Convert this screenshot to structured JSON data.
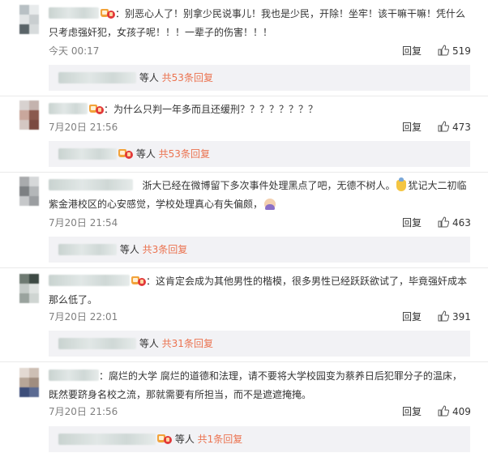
{
  "reply_label": "回复",
  "others_label": "等人",
  "icons": {
    "like": "thumbs-up-icon",
    "vip": "vip-crown-icon"
  },
  "colors": {
    "accent": "#eb7350",
    "meta": "#808080",
    "sub_bg": "#f2f2f5"
  },
  "comments": [
    {
      "text_1": "：别恶心人了！别拿少民说事儿！我也是少民，开除！坐牢！该干嘛干嘛！凭什么",
      "text_2": "只考虑强奸犯，女孩子呢！！！一辈子的伤害！！！",
      "time": "今天 00:17",
      "likes": "519",
      "sub_count": "共53条回复"
    },
    {
      "text_1": "：为什么只判一年多而且还缓刑？？？？？？？？",
      "time": "7月20日 21:56",
      "likes": "473",
      "sub_count": "共53条回复"
    },
    {
      "text_1a": "浙大已经在微博留下多次事件处理黑点了吧，无德不树人。",
      "text_1b": "犹记大二初临",
      "text_2": "紫金港校区的心安感觉，学校处理真心有失偏颇，",
      "time": "7月20日 21:54",
      "likes": "463",
      "sub_count": "共3条回复"
    },
    {
      "text_1": "：这肯定会成为其他男性的楷模，很多男性已经跃跃欲试了，毕竟强奸成本",
      "text_2": "那么低了。",
      "time": "7月20日 22:01",
      "likes": "391",
      "sub_count": "共31条回复"
    },
    {
      "text_1": "：腐烂的大学 腐烂的道德和法理，请不要将大学校园变为蔡养日后犯罪分子的温床，",
      "text_2": "既然要跻身名校之流，那就需要有所担当，而不是遮遮掩掩。",
      "time": "7月20日 21:56",
      "likes": "409",
      "sub_count": "共1条回复"
    }
  ]
}
